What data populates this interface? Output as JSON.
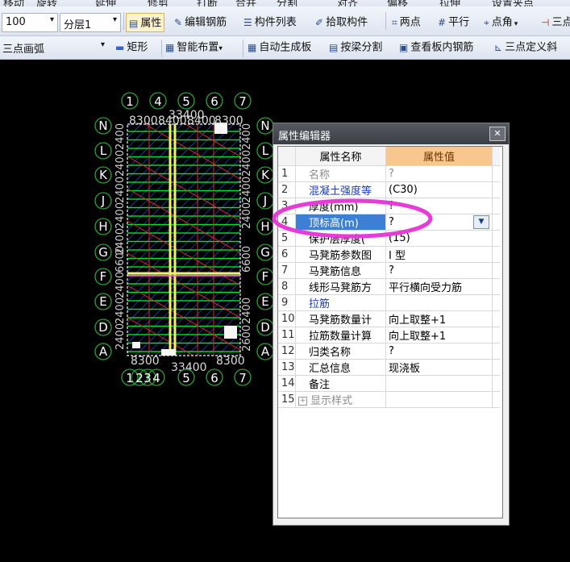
{
  "toolbar_top": {
    "items": [
      "移动",
      "旋转",
      "延伸",
      "修剪",
      "打断",
      "合并",
      "分割",
      "对齐",
      "偏移",
      "拉伸",
      "设置夹点"
    ]
  },
  "toolbar1": {
    "scale_combo": "100",
    "layer_combo": "分层1",
    "attr_button": "属性",
    "edit_rebar_button": "编辑钢筋",
    "member_list_button": "构件列表",
    "pick_member_button": "拾取构件",
    "two_points_button": "两点",
    "parallel_button": "平行",
    "point_angle_button": "点角",
    "three_button": "三点"
  },
  "toolbar2": {
    "arc_combo": "三点画弧",
    "rect_button": "矩形",
    "smart_layout_button": "智能布置",
    "auto_slab_button": "自动生成板",
    "beam_split_button": "按梁分割",
    "view_slab_rebar_button": "查看板内钢筋",
    "three_point_slope_button": "三点定义斜"
  },
  "canvas": {
    "top_axes": [
      "1",
      "4",
      "5",
      "6",
      "7"
    ],
    "bottom_axes": [
      "1",
      "2",
      "3",
      "4",
      "5",
      "6",
      "7"
    ],
    "row_axes": [
      "N",
      "L",
      "K",
      "J",
      "H",
      "G",
      "F",
      "E",
      "D",
      "A"
    ],
    "top_dims": [
      "33400",
      "8300",
      "8400",
      "8400",
      "8300"
    ],
    "bottom_dims": [
      "33400",
      "8300"
    ],
    "side_dims": [
      "2400",
      "2400",
      "2400",
      "2400",
      "2400",
      "6600",
      "2400",
      "2400",
      "2400",
      "2600"
    ]
  },
  "property_editor": {
    "title": "属性编辑器",
    "close": "✕",
    "col_name": "属性名称",
    "col_value": "属性值",
    "rows": [
      {
        "num": "1",
        "name": "名称",
        "value": "?"
      },
      {
        "num": "2",
        "name": "混凝土强度等",
        "value": "(C30)"
      },
      {
        "num": "3",
        "name": "厚度(mm)",
        "value": "?"
      },
      {
        "num": "4",
        "name": "顶标高(m)",
        "value": "?"
      },
      {
        "num": "5",
        "name": "保护层厚度(",
        "value": "(15)"
      },
      {
        "num": "6",
        "name": "马凳筋参数图",
        "value": "I 型"
      },
      {
        "num": "7",
        "name": "马凳筋信息",
        "value": "?"
      },
      {
        "num": "8",
        "name": "线形马凳筋方",
        "value": "平行横向受力筋"
      },
      {
        "num": "9",
        "name": "拉筋",
        "value": ""
      },
      {
        "num": "10",
        "name": "马凳筋数量计",
        "value": "向上取整+1"
      },
      {
        "num": "11",
        "name": "拉筋数量计算",
        "value": "向上取整+1"
      },
      {
        "num": "12",
        "name": "归类名称",
        "value": "?"
      },
      {
        "num": "13",
        "name": "汇总信息",
        "value": "现浇板"
      },
      {
        "num": "14",
        "name": "备注",
        "value": ""
      },
      {
        "num": "15",
        "name": "显示样式",
        "value": ""
      }
    ],
    "expand_icon": "+",
    "dropdown_icon": "▼"
  },
  "colors": {
    "highlight_ellipse": "#e83ad8",
    "axis_circle": "#27a635",
    "slab_green": "#00dd22",
    "hatch_red": "#e0282f",
    "beam_yellow": "#f3f06a",
    "selected_row": "#3e7fd6",
    "value_header": "#f8c78f"
  }
}
